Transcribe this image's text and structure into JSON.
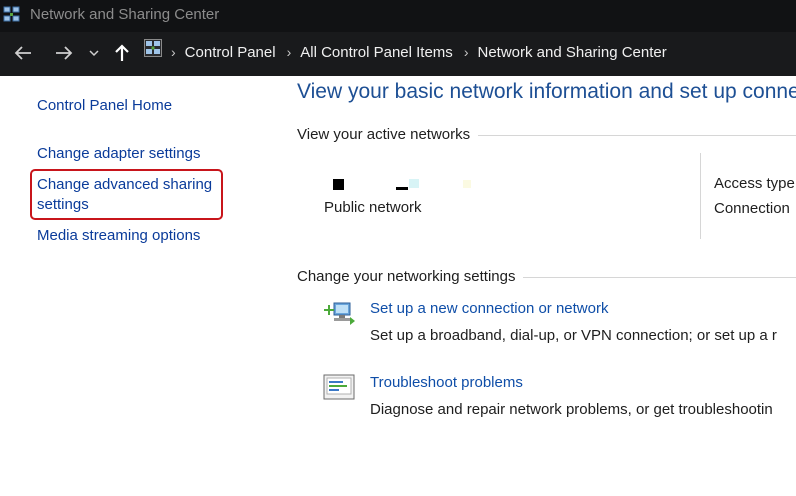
{
  "window": {
    "title": "Network and Sharing Center"
  },
  "address_bar": {
    "breadcrumbs": [
      "Control Panel",
      "All Control Panel Items",
      "Network and Sharing Center"
    ]
  },
  "left_pane": {
    "home": "Control Panel Home",
    "links": [
      "Change adapter settings",
      "Change advanced sharing settings",
      "Media streaming options"
    ],
    "highlighted_index": 1,
    "highlight_color": "#c8151b"
  },
  "main": {
    "heading": "View your basic network information and set up conne",
    "active_networks_label": "View your active networks",
    "network": {
      "type": "Public network",
      "access_type_label": "Access type",
      "connections_label": "Connection"
    },
    "networking_settings_label": "Change your networking settings",
    "tasks": [
      {
        "icon": "new-connection-icon",
        "title": "Set up a new connection or network",
        "description": "Set up a broadband, dial-up, or VPN connection; or set up a r"
      },
      {
        "icon": "troubleshoot-icon",
        "title": "Troubleshoot problems",
        "description": "Diagnose and repair network problems, or get troubleshootin"
      }
    ]
  },
  "colors": {
    "link": "#0a3b9a",
    "heading": "#1d4f94",
    "titlebar": "#111214"
  }
}
